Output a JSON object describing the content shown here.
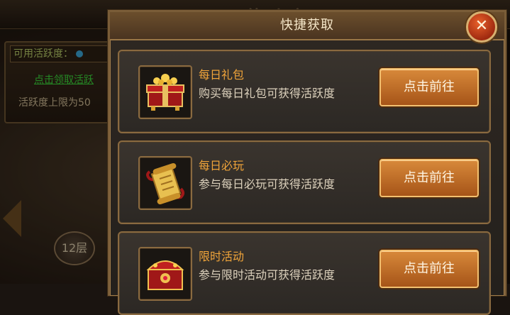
{
  "background": {
    "title": "Fil 练功房",
    "left_panel": {
      "available_activity_label": "可用活跃度：",
      "claim_link": "点击领取活跃",
      "limit_text": "活跃度上限为50"
    },
    "level_badge": "12层"
  },
  "modal": {
    "title": "快捷获取",
    "close_label": "✕",
    "items": [
      {
        "title": "每日礼包",
        "desc": "购买每日礼包可获得活跃度",
        "button": "点击前往",
        "icon": "gift-chest-icon"
      },
      {
        "title": "每日必玩",
        "desc": "参与每日必玩可获得活跃度",
        "button": "点击前往",
        "icon": "scroll-icon"
      },
      {
        "title": "限时活动",
        "desc": "参与限时活动可获得活跃度",
        "button": "点击前往",
        "icon": "treasure-chest-icon"
      }
    ]
  },
  "colors": {
    "accent_orange": "#f0a43a",
    "button_orange": "#c06a28",
    "frame_gold": "#8a6a40"
  }
}
